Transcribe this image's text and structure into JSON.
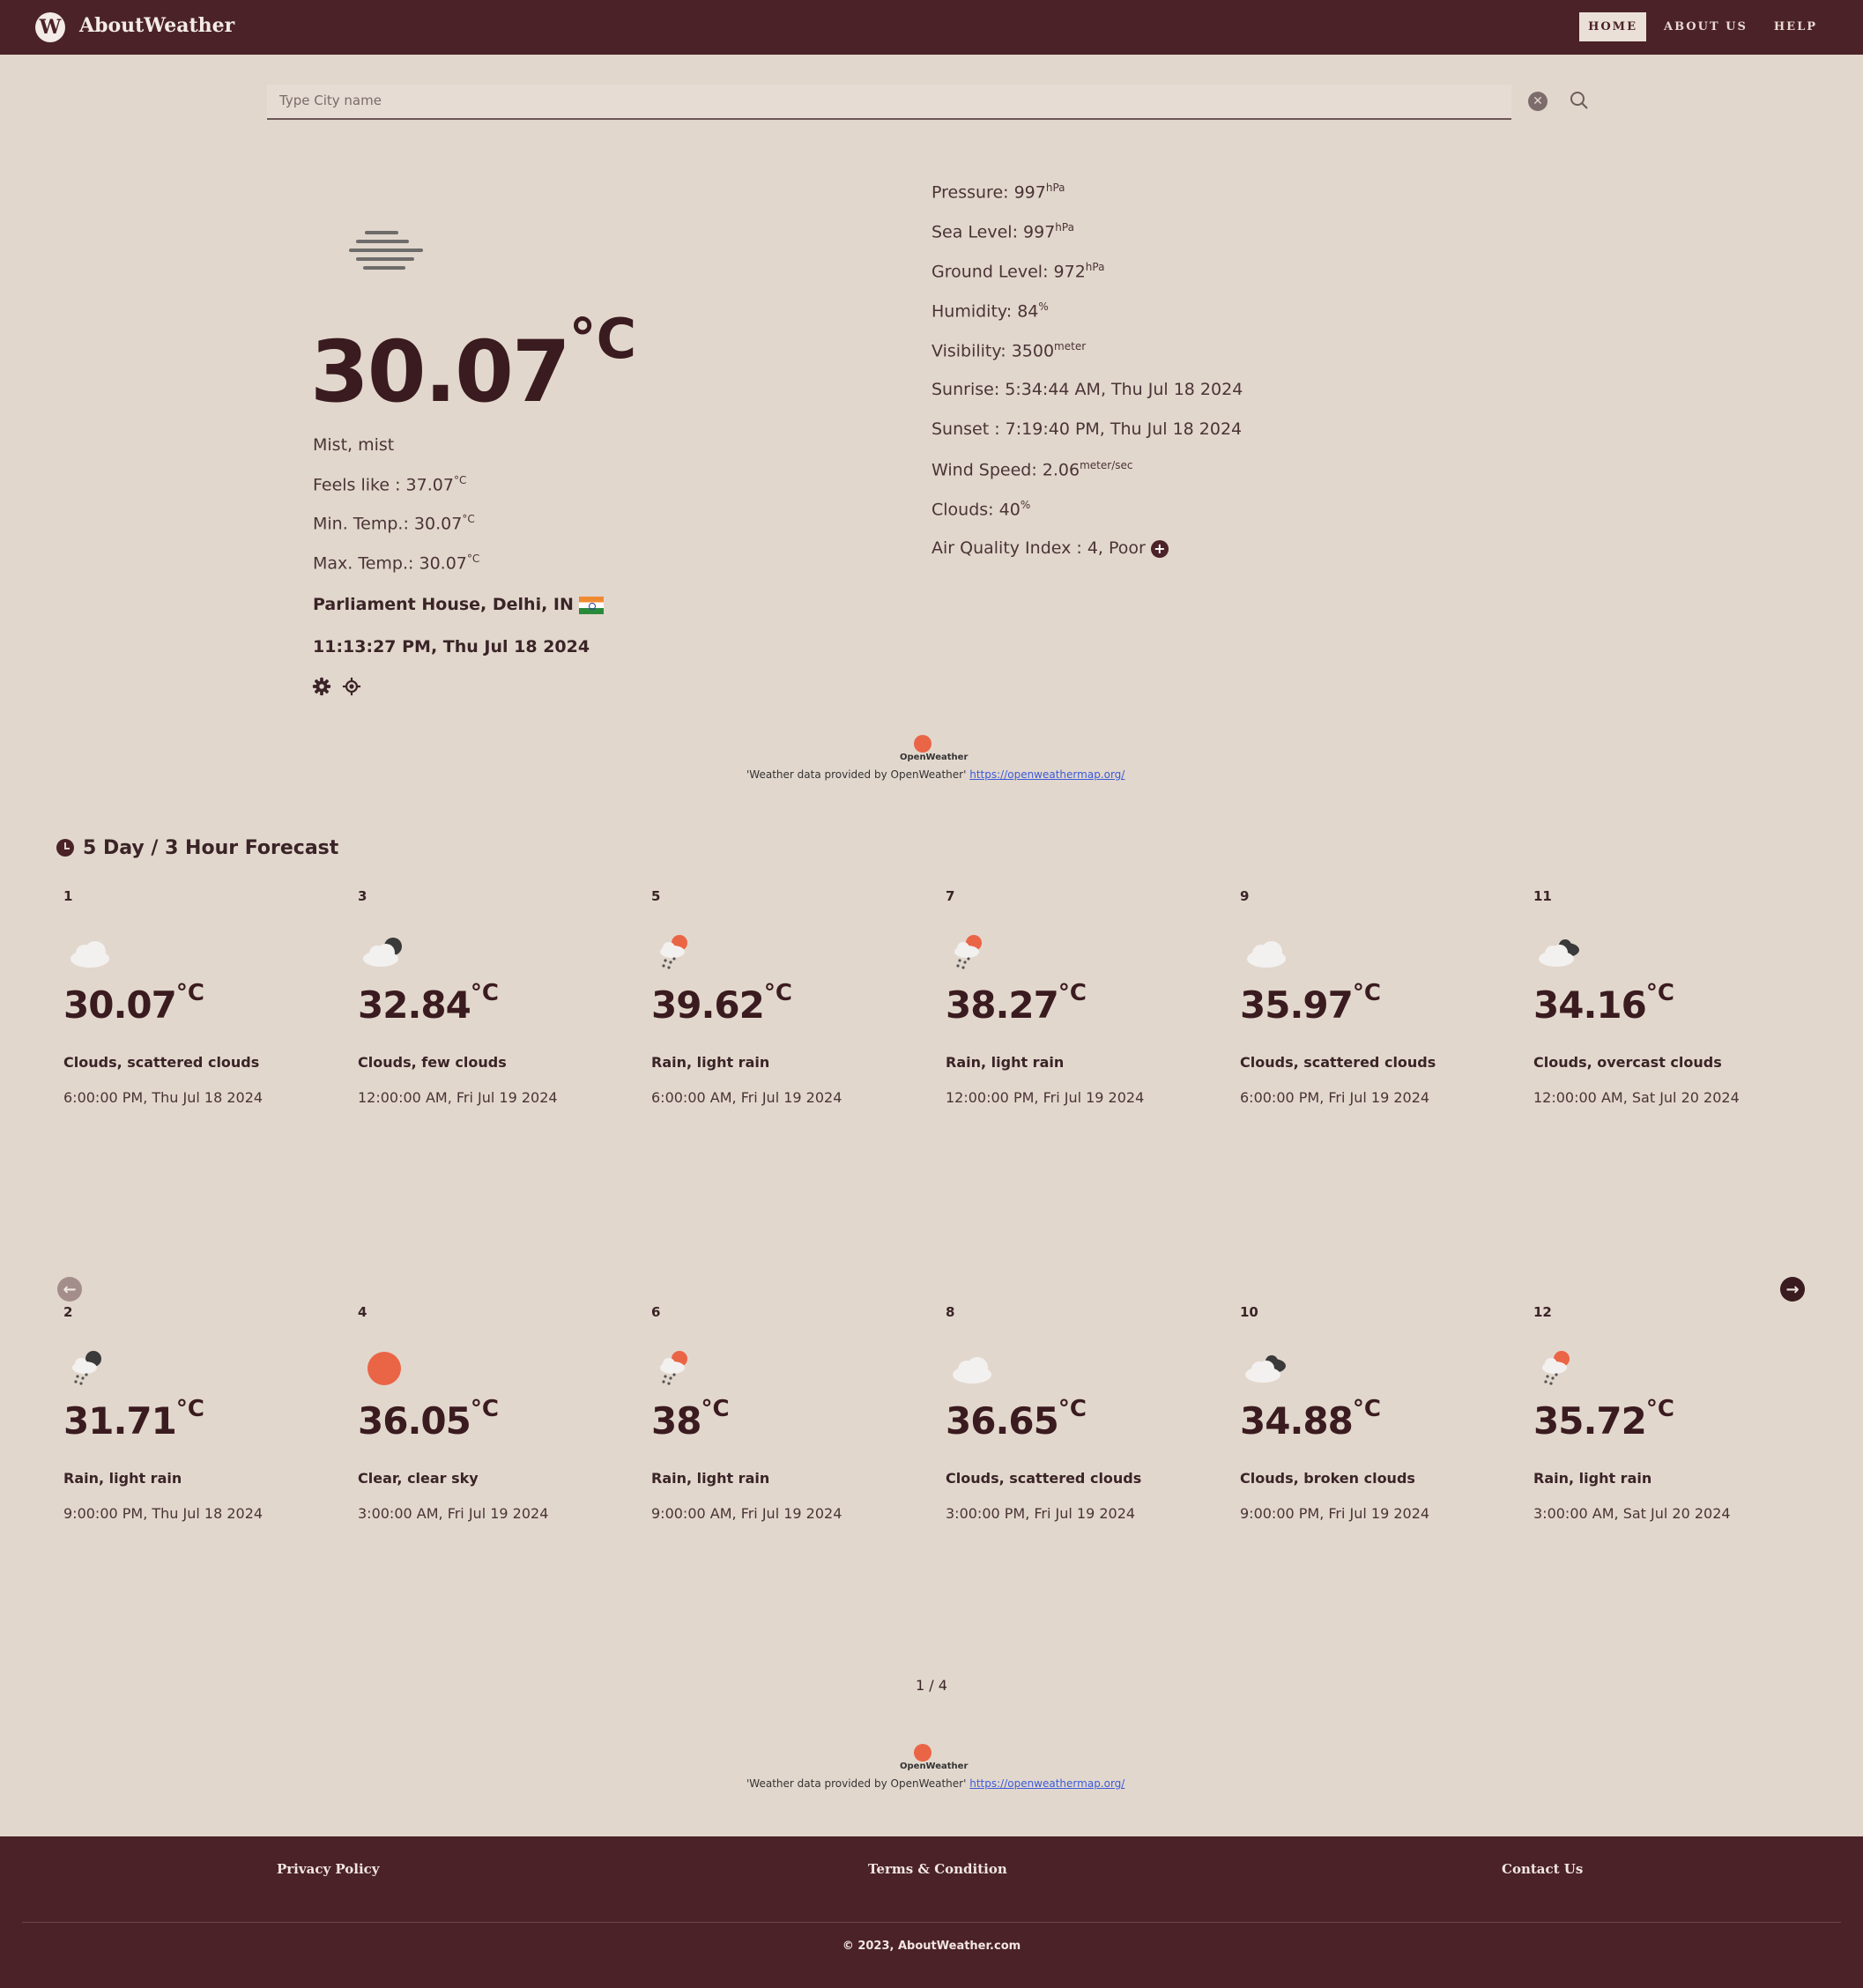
{
  "header": {
    "logo_letter": "W",
    "brand": "AboutWeather",
    "nav": [
      {
        "label": "HOME",
        "active": true
      },
      {
        "label": "ABOUT US",
        "active": false
      },
      {
        "label": "HELP",
        "active": false
      }
    ]
  },
  "search": {
    "placeholder": "Type City name",
    "value": ""
  },
  "current": {
    "icon": "mist-icon",
    "temp": "30.07",
    "unit": "°C",
    "description": "Mist, mist",
    "feels_like_label": "Feels like : ",
    "feels_like": "37.07",
    "min_temp_label": "Min. Temp.: ",
    "min_temp": "30.07",
    "max_temp_label": "Max. Temp.: ",
    "max_temp": "30.07",
    "location": "Parliament House, Delhi, IN",
    "datetime": "11:13:27 PM, Thu Jul 18 2024"
  },
  "details": {
    "pressure_label": "Pressure: ",
    "pressure": "997",
    "pressure_unit": "hPa",
    "sea_label": "Sea Level: ",
    "sea": "997",
    "sea_unit": "hPa",
    "ground_label": "Ground Level: ",
    "ground": "972",
    "ground_unit": "hPa",
    "humidity_label": "Humidity: ",
    "humidity": "84",
    "humidity_unit": "%",
    "visibility_label": "Visibility: ",
    "visibility": "3500",
    "visibility_unit": "meter",
    "sunrise": "Sunrise: 5:34:44 AM, Thu Jul 18 2024",
    "sunset": "Sunset : 7:19:40 PM, Thu Jul 18 2024",
    "wind_label": "Wind Speed: ",
    "wind": "2.06",
    "wind_unit": "meter/sec",
    "clouds_label": "Clouds: ",
    "clouds": "40",
    "clouds_unit": "%",
    "aqi": "Air Quality Index : 4, Poor",
    "aqi_more": "+"
  },
  "attribution": {
    "name": "OpenWeather",
    "text": "'Weather data provided by OpenWeather'",
    "url": "https://openweathermap.org/"
  },
  "forecast": {
    "title": "5 Day / 3 Hour Forecast",
    "unit": "°C",
    "cards": [
      {
        "num": "1",
        "icon": "cloud-icon",
        "temp": "30.07",
        "desc": "Clouds, scattered clouds",
        "time": "6:00:00 PM, Thu Jul 18 2024"
      },
      {
        "num": "3",
        "icon": "cloud-night-icon",
        "temp": "32.84",
        "desc": "Clouds, few clouds",
        "time": "12:00:00 AM, Fri Jul 19 2024"
      },
      {
        "num": "5",
        "icon": "rain-sun-icon",
        "temp": "39.62",
        "desc": "Rain, light rain",
        "time": "6:00:00 AM, Fri Jul 19 2024"
      },
      {
        "num": "7",
        "icon": "rain-sun-icon",
        "temp": "38.27",
        "desc": "Rain, light rain",
        "time": "12:00:00 PM, Fri Jul 19 2024"
      },
      {
        "num": "9",
        "icon": "cloud-icon",
        "temp": "35.97",
        "desc": "Clouds, scattered clouds",
        "time": "6:00:00 PM, Fri Jul 19 2024"
      },
      {
        "num": "11",
        "icon": "overcast-icon",
        "temp": "34.16",
        "desc": "Clouds, overcast clouds",
        "time": "12:00:00 AM, Sat Jul 20 2024"
      },
      {
        "num": "2",
        "icon": "rain-night-icon",
        "temp": "31.71",
        "desc": "Rain, light rain",
        "time": "9:00:00 PM, Thu Jul 18 2024"
      },
      {
        "num": "4",
        "icon": "sun-icon",
        "temp": "36.05",
        "desc": "Clear, clear sky",
        "time": "3:00:00 AM, Fri Jul 19 2024"
      },
      {
        "num": "6",
        "icon": "rain-sun-icon",
        "temp": "38",
        "desc": "Rain, light rain",
        "time": "9:00:00 AM, Fri Jul 19 2024"
      },
      {
        "num": "8",
        "icon": "cloud-icon",
        "temp": "36.65",
        "desc": "Clouds, scattered clouds",
        "time": "3:00:00 PM, Fri Jul 19 2024"
      },
      {
        "num": "10",
        "icon": "overcast-icon",
        "temp": "34.88",
        "desc": "Clouds, broken clouds",
        "time": "9:00:00 PM, Fri Jul 19 2024"
      },
      {
        "num": "12",
        "icon": "rain-sun-icon",
        "temp": "35.72",
        "desc": "Rain, light rain",
        "time": "3:00:00 AM, Sat Jul 20 2024"
      }
    ],
    "pager": "1 / 4"
  },
  "footer": {
    "privacy": "Privacy Policy",
    "terms": "Terms & Condition",
    "contact": "Contact Us",
    "copyright": "© 2023, AboutWeather.com"
  },
  "colors": {
    "brand": "#4a2227",
    "background": "#e2d7cd",
    "sun": "#ea6546",
    "link": "#3b5bd8"
  }
}
